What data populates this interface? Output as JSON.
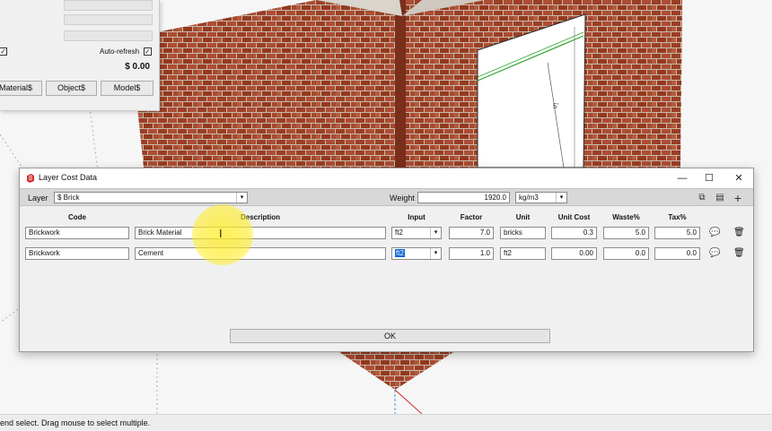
{
  "status_bar": {
    "text": "end select. Drag mouse to select multiple."
  },
  "estimator_panel": {
    "autorefresh_label": "Auto-refresh",
    "autorefresh_checked": true,
    "left_checkbox_checked": true,
    "total": "$ 0.00",
    "buttons": [
      "Material$",
      "Object$",
      "Model$"
    ]
  },
  "dialog": {
    "title": "Layer Cost Data",
    "window_buttons": {
      "minimize": "—",
      "maximize": "☐",
      "close": "✕"
    },
    "layer_label": "Layer",
    "layer_value": "$ Brick",
    "weight_label": "Weight",
    "weight_value": "1920.0",
    "weight_unit": "kg/m3",
    "toolbar_icons": [
      "copy-icon",
      "clipboard-icon",
      "plus-icon"
    ],
    "columns": [
      "Code",
      "Description",
      "Input",
      "Factor",
      "Unit",
      "Unit Cost",
      "Waste%",
      "Tax%"
    ],
    "rows": [
      {
        "code": "Brickwork",
        "description": "Brick Material",
        "input": "ft2",
        "factor": "7.0",
        "unit": "bricks",
        "unit_cost": "0.3",
        "waste": "5.0",
        "tax": "5.0",
        "input_selected": false
      },
      {
        "code": "Brickwork",
        "description": "Cement",
        "input": "ft2",
        "factor": "1.0",
        "unit": "ft2",
        "unit_cost": "0.00",
        "waste": "0.0",
        "tax": "0.0",
        "input_selected": true
      }
    ],
    "ok_label": "OK"
  },
  "scene": {
    "annotation_text": "5'"
  },
  "colors": {
    "accent_selection": "#0a64d8",
    "app_icon_red": "#d32f2f",
    "highlight_yellow": "#ffec28"
  }
}
